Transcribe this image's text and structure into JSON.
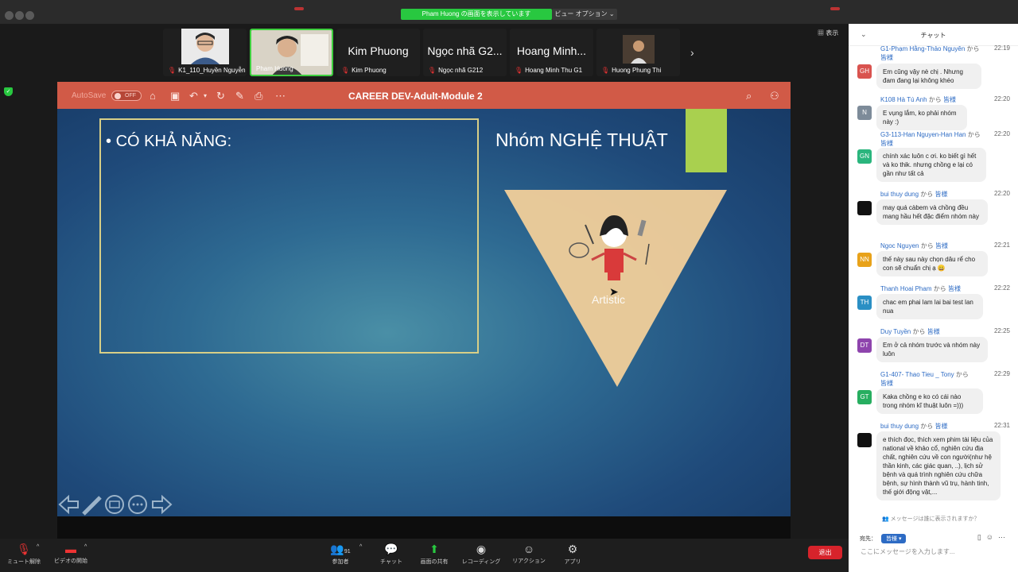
{
  "window": {
    "share_banner": "Pham Huong の画面を表示しています",
    "view_options": "ビュー オプション ⌄"
  },
  "thumbnails": [
    {
      "label": "K1_110_Huyền Nguyễn",
      "big": "",
      "has_video": true,
      "muted": true
    },
    {
      "label": "Pham Huong",
      "big": "",
      "has_video": true,
      "muted": false,
      "active": true
    },
    {
      "label": "Kim Phuong",
      "big": "Kim Phuong",
      "muted": true
    },
    {
      "label": "Ngọc nhã G212",
      "big": "Ngọc nhã G2...",
      "muted": true
    },
    {
      "label": "Hoang Minh Thu G1",
      "big": "Hoang Minh...",
      "muted": true
    },
    {
      "label": "Huong Phung Thi",
      "big": "",
      "has_video": true,
      "muted": true
    }
  ],
  "display_label": "表示",
  "ppt": {
    "autosave": "AutoSave",
    "toggle": "OFF",
    "title": "CAREER DEV-Adult-Module 2"
  },
  "slide": {
    "bullet": "CÓ KHẢ NĂNG:",
    "group_title": "Nhóm NGHỆ THUẬT",
    "triangle_label": "Artistic"
  },
  "toolbar": {
    "mute": "ミュート解除",
    "video": "ビデオの開始",
    "participants": "参加者",
    "participants_count": "91",
    "chat": "チャット",
    "share": "画面の共有",
    "record": "レコーディング",
    "reactions": "リアクション",
    "apps": "アプリ",
    "end": "退出"
  },
  "chat": {
    "title": "チャット",
    "kara": "から",
    "everyone": "皆様",
    "messages": [
      {
        "initials": "GH",
        "color": "#d9534f",
        "from": "G1-Phạm Hằng-Thảo Nguyên",
        "time": "22:19",
        "text": "Em cũng vậy nè chị . Nhưng đam đang lại không khéo"
      },
      {
        "initials": "N",
        "color": "#7d8b99",
        "from": "K108 Hà Tú Anh",
        "time": "22:20",
        "text": "E vụng lắm, ko phải nhóm này :)"
      },
      {
        "initials": "GN",
        "color": "#2ab57d",
        "from": "G3-113-Han Nguyen-Han Han",
        "time": "22:20",
        "text": "chính xác luôn c ơi. ko biết gì hết và ko thik. nhưng chồng e lại có gần như tất cả"
      },
      {
        "initials": "",
        "color": "#111111",
        "from": "bui thuy dung",
        "time": "22:20",
        "text": "may quá càbem và chồng đều mang hầu hết đặc điểm nhóm này"
      },
      {
        "initials": "NN",
        "color": "#e8a21a",
        "from": "Ngoc Nguyen",
        "time": "22:21",
        "text": "thế này sau này chọn dâu rể cho con sẽ chuẩn chị ạ 😀"
      },
      {
        "initials": "TH",
        "color": "#2a8fc4",
        "from": "Thanh Hoai Pham",
        "time": "22:22",
        "text": "chac em phai lam lai bai test lan nua"
      },
      {
        "initials": "DT",
        "color": "#8e44ad",
        "from": "Duy Tuyền",
        "time": "22:25",
        "text": "Em ở cả nhóm trước và nhóm này luôn"
      },
      {
        "initials": "GT",
        "color": "#27ae60",
        "from": "G1-407- Thao Tieu _ Tony",
        "time": "22:29",
        "text": "Kaka chồng e ko có cái nào trong nhóm kĩ thuật luôn =)))"
      },
      {
        "initials": "",
        "color": "#111111",
        "from": "bui thuy dung",
        "time": "22:31",
        "text": "e thích đọc, thích xem phim tài liệu của national về khảo cổ, nghiên cứu địa chất, nghiên cứu về con người(như hệ thần kinh, các giác quan, ..), lịch sử bệnh và quá trình nghiên cứu chữa bệnh, sự hình thành vũ trụ, hành tinh, thế giới động vật,..."
      }
    ],
    "visibility_note": "メッセージは誰に表示されますか？",
    "to_label": "宛先：",
    "to_value": "皆様",
    "input_placeholder": "ここにメッセージを入力します..."
  }
}
